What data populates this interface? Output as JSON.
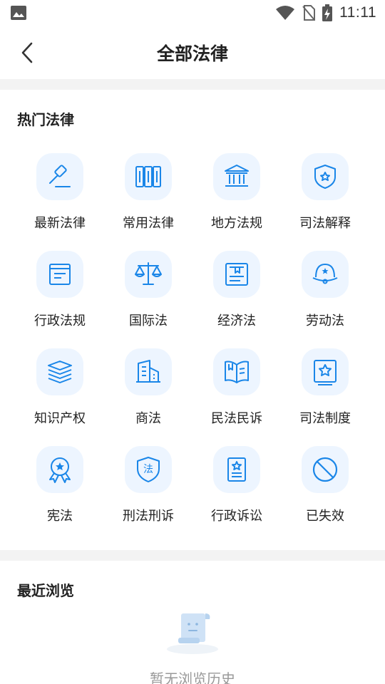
{
  "status_bar": {
    "time": "11:11",
    "icons": [
      "image-icon",
      "wifi-icon",
      "no-sim-icon",
      "battery-charging-icon"
    ]
  },
  "header": {
    "title": "全部法律",
    "back_icon": "chevron-left-icon"
  },
  "hot_section": {
    "title": "热门法律",
    "accent_color": "#1a86e8",
    "icon_bg_color": "#edf5ff",
    "items": [
      {
        "label": "最新法律",
        "icon": "gavel-icon"
      },
      {
        "label": "常用法律",
        "icon": "books-icon"
      },
      {
        "label": "地方法规",
        "icon": "courthouse-icon"
      },
      {
        "label": "司法解释",
        "icon": "shield-star-icon"
      },
      {
        "label": "行政法规",
        "icon": "notebook-icon"
      },
      {
        "label": "国际法",
        "icon": "scales-icon"
      },
      {
        "label": "经济法",
        "icon": "bookmark-document-icon"
      },
      {
        "label": "劳动法",
        "icon": "helmet-icon"
      },
      {
        "label": "知识产权",
        "icon": "stacked-books-icon"
      },
      {
        "label": "商法",
        "icon": "buildings-icon"
      },
      {
        "label": "民法民诉",
        "icon": "open-book-icon"
      },
      {
        "label": "司法制度",
        "icon": "star-frame-icon"
      },
      {
        "label": "宪法",
        "icon": "award-badge-icon"
      },
      {
        "label": "刑法刑诉",
        "icon": "law-shield-icon"
      },
      {
        "label": "行政诉讼",
        "icon": "star-document-icon"
      },
      {
        "label": "已失效",
        "icon": "forbidden-icon"
      }
    ]
  },
  "recent_section": {
    "title": "最近浏览",
    "empty_text": "暂无浏览历史",
    "empty_icon": "empty-scroll-icon"
  }
}
